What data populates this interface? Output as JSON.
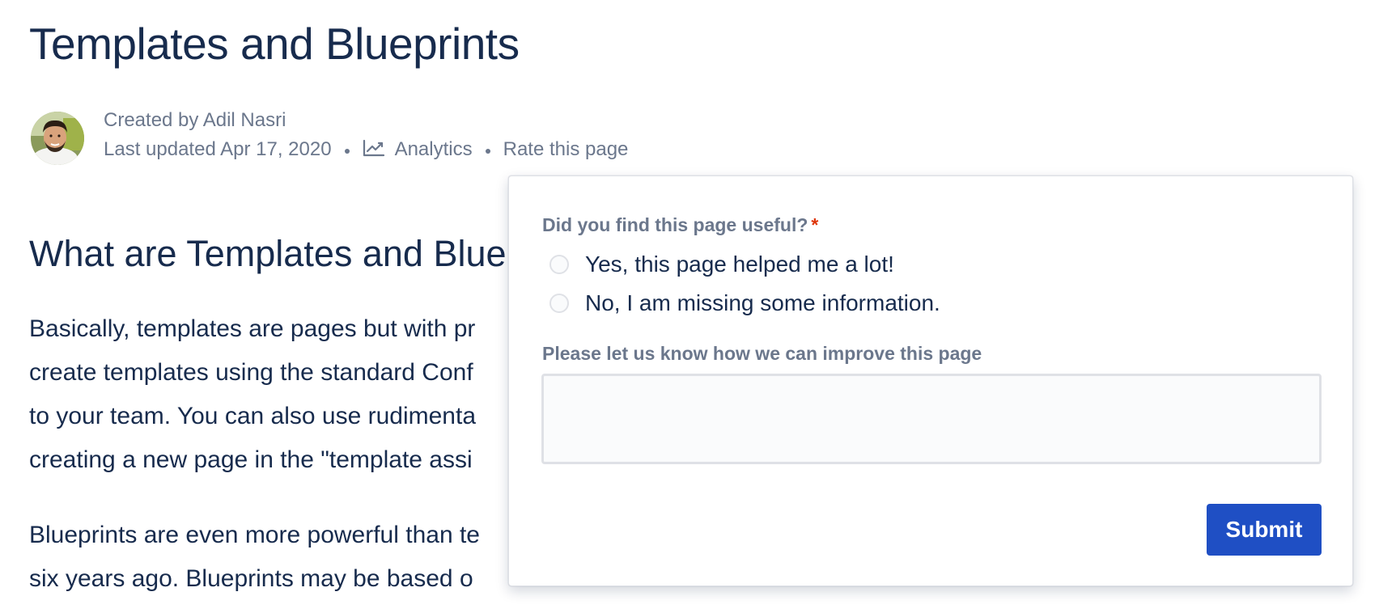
{
  "page": {
    "title": "Templates and Blueprints"
  },
  "byline": {
    "created_by": "Created by Adil Nasri",
    "last_updated": "Last updated Apr 17, 2020",
    "analytics_label": "Analytics",
    "rate_label": "Rate this page"
  },
  "content": {
    "heading": "What are Templates and Bluep",
    "para1_lines": [
      "Basically, templates are pages but with pr",
      "create templates using the standard Conf",
      "to your team. You can also use rudimenta",
      "creating a new page in the \"template assi"
    ],
    "para2_lines": [
      "Blueprints are even more powerful than te",
      "six years ago. Blueprints may be based o"
    ]
  },
  "rating_popup": {
    "question": "Did you find this page useful?",
    "required_marker": "*",
    "options": [
      "Yes, this page helped me a lot!",
      "No, I am missing some information."
    ],
    "improve_label": "Please let us know how we can improve this page",
    "textarea_value": "",
    "submit_label": "Submit"
  },
  "colors": {
    "heading_text": "#172B4D",
    "meta_text": "#6B778C",
    "submit_bg": "#1F4FC4",
    "required": "#DE350B",
    "border": "#DFE1E6"
  },
  "icons": {
    "analytics": "analytics-chart-icon",
    "avatar": "user-avatar"
  }
}
